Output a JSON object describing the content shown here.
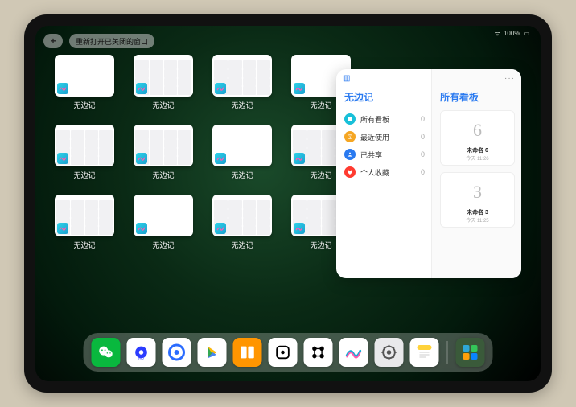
{
  "status": {
    "battery": "100%",
    "wifi": "●"
  },
  "topbar": {
    "plus_label": "+",
    "reopen_label": "重新打开已关闭的窗口"
  },
  "app_common": {
    "label": "无边记",
    "icon_name": "freeform-icon"
  },
  "grid_windows": [
    {
      "variant": "blank"
    },
    {
      "variant": "calendar"
    },
    {
      "variant": "calendar"
    },
    {
      "variant": "blank"
    },
    {
      "variant": "calendar"
    },
    {
      "variant": "calendar"
    },
    {
      "variant": "blank"
    },
    {
      "variant": "calendar"
    },
    {
      "variant": "calendar"
    },
    {
      "variant": "blank"
    },
    {
      "variant": "calendar"
    },
    {
      "variant": "calendar"
    }
  ],
  "panel": {
    "title": "无边记",
    "right_title": "所有看板",
    "items": [
      {
        "color": "#18c0d9",
        "label": "所有看板",
        "count": "0"
      },
      {
        "color": "#f5a623",
        "label": "最近使用",
        "count": "0"
      },
      {
        "color": "#2a7af0",
        "label": "已共享",
        "count": "0"
      },
      {
        "color": "#ff3b30",
        "label": "个人收藏",
        "count": "0"
      }
    ],
    "boards": [
      {
        "glyph": "6",
        "name": "未命名 6",
        "date": "今天 11:26"
      },
      {
        "glyph": "3",
        "name": "未命名 3",
        "date": "今天 11:25"
      }
    ]
  },
  "dock": {
    "main": [
      {
        "name": "wechat",
        "bg": "#09b83e"
      },
      {
        "name": "quark-hd",
        "bg": "#ffffff"
      },
      {
        "name": "quark",
        "bg": "#ffffff"
      },
      {
        "name": "play",
        "bg": "#ffffff"
      },
      {
        "name": "books",
        "bg": "#ff9500"
      },
      {
        "name": "dice",
        "bg": "#ffffff"
      },
      {
        "name": "connect",
        "bg": "#ffffff"
      },
      {
        "name": "freeform",
        "bg": "#ffffff"
      },
      {
        "name": "settings",
        "bg": "#e9e9eb"
      },
      {
        "name": "notes",
        "bg": "#ffffff"
      }
    ],
    "recent": [
      {
        "name": "app-library",
        "bg": "#3a5a3a"
      }
    ]
  }
}
